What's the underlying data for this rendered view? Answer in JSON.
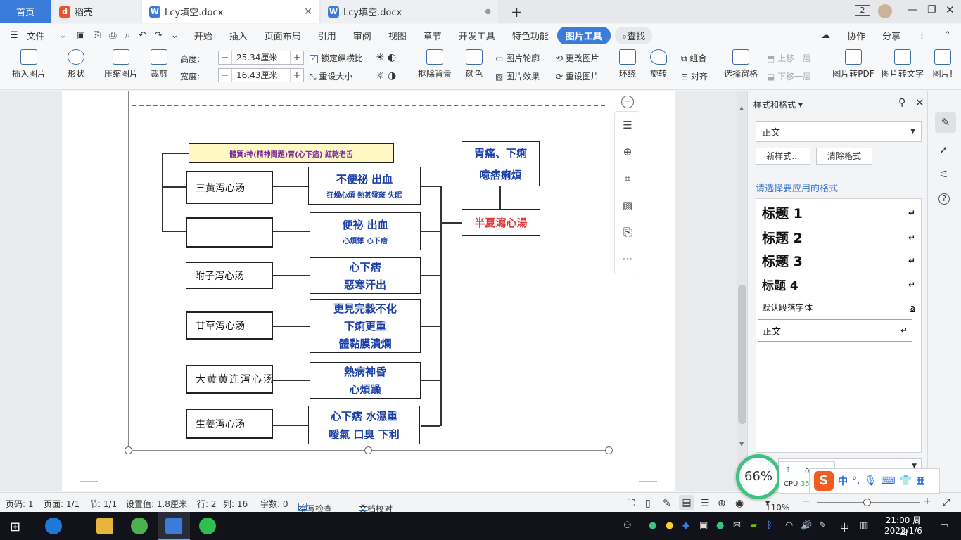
{
  "tabs": {
    "home": "首页",
    "t1": "稻壳",
    "t2": "Lcy填空.docx",
    "t3": "Lcy填空.docx",
    "new": "+",
    "count": "2"
  },
  "menu": {
    "file": "文件",
    "items": [
      "开始",
      "插入",
      "页面布局",
      "引用",
      "审阅",
      "视图",
      "章节",
      "开发工具",
      "特色功能"
    ],
    "active": "图片工具",
    "search": "查找",
    "collab": "协作",
    "share": "分享"
  },
  "ribbon": {
    "insert_pic": "插入图片",
    "shape": "形状",
    "compress": "压缩图片",
    "crop": "裁剪",
    "height_label": "高度:",
    "height_val": "25.34厘米",
    "width_label": "宽度:",
    "width_val": "16.43厘米",
    "lock_ratio": "锁定纵横比",
    "reset_size": "重设大小",
    "remove_bg": "抠除背景",
    "color": "颜色",
    "outline": "图片轮廓",
    "effect": "图片效果",
    "change_pic": "更改图片",
    "reset_pic": "重设图片",
    "wrap": "环绕",
    "rotate": "旋转",
    "group": "组合",
    "align": "对齐",
    "select_pane": "选择窗格",
    "bring_fwd": "上移一层",
    "send_back": "下移一层",
    "to_pdf": "图片转PDF",
    "to_text": "图片转文字",
    "more": "图片!"
  },
  "diagram": {
    "top_label": "體質:神(精神問題)胃(心下痞) 紅乾老舌",
    "left": [
      "三黄泻心汤",
      "",
      "附子泻心汤",
      "甘草泻心汤",
      "大黄黄连泻心汤",
      "生姜泻心汤"
    ],
    "mid": [
      {
        "main": "不便祕  出血",
        "sub": "狂燥心煩 熱甚發斑 失眠"
      },
      {
        "main": "便祕 出血",
        "sub": "心煩悸 心下痞"
      },
      {
        "main": "心下痞",
        "sub2": "惡寒汗出"
      },
      {
        "main": "更見完穀不化",
        "sub2": "下痢更重",
        "sub3": "體黏膜潰爛"
      },
      {
        "main": "熱病神昏",
        "sub2": "心煩躁"
      },
      {
        "main": "心下痞 水濕重",
        "sub2": "噯氣 口臭 下利"
      }
    ],
    "right_top": [
      "胃痛、下痢",
      "噫痞痢煩"
    ],
    "right_mid": "半夏瀉心湯"
  },
  "panel": {
    "title": "样式和格式",
    "current": "正文",
    "new_style": "新样式...",
    "clear": "清除格式",
    "prompt": "请选择要应用的格式",
    "styles": [
      "标题  1",
      "标题  2",
      "标题  3",
      "标题  4",
      "默认段落字体",
      "正文"
    ],
    "default_mark": "a"
  },
  "status": {
    "page": "页码: 1",
    "pages": "页面: 1/1",
    "section": "节: 1/1",
    "setting": "设置值: 1.8厘米",
    "row": "行: 2",
    "col": "列: 16",
    "words": "字数: 0",
    "spell": "拼写检查",
    "proof": "文档校对",
    "zoom": "110%"
  },
  "widgets": {
    "cpu_pct": "66%",
    "net": "0K/s",
    "cpu_label": "CPU",
    "cpu_temp": "35°C"
  },
  "taskbar": {
    "time": "21:00 周四",
    "date": "2022/1/6",
    "ime": "中"
  },
  "colors": {
    "accent": "#3b7bd9",
    "diagram_text": "#1a3fa8",
    "red": "#e03a3a",
    "highlight": "#fff8c4"
  }
}
